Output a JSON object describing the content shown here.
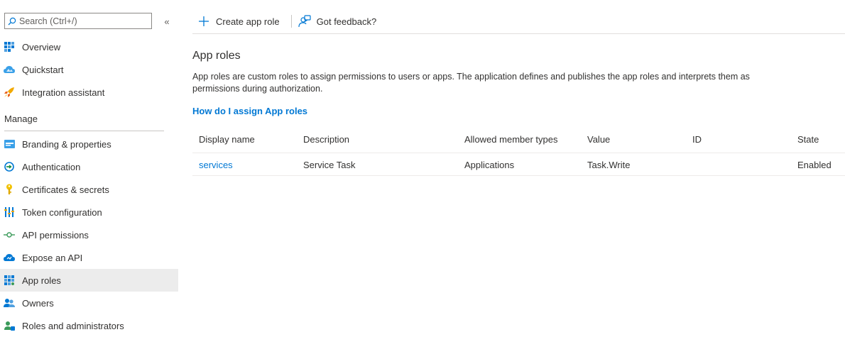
{
  "search": {
    "placeholder": "Search (Ctrl+/)"
  },
  "sidebar": {
    "collapse_glyph": "«",
    "top_items": [
      {
        "label": "Overview",
        "icon": "overview-icon"
      },
      {
        "label": "Quickstart",
        "icon": "quickstart-icon"
      },
      {
        "label": "Integration assistant",
        "icon": "rocket-icon"
      }
    ],
    "section_title": "Manage",
    "manage_items": [
      {
        "label": "Branding & properties",
        "icon": "branding-icon"
      },
      {
        "label": "Authentication",
        "icon": "authentication-icon"
      },
      {
        "label": "Certificates & secrets",
        "icon": "key-icon"
      },
      {
        "label": "Token configuration",
        "icon": "token-icon"
      },
      {
        "label": "API permissions",
        "icon": "api-permissions-icon"
      },
      {
        "label": "Expose an API",
        "icon": "cloud-icon"
      },
      {
        "label": "App roles",
        "icon": "app-roles-icon",
        "active": true
      },
      {
        "label": "Owners",
        "icon": "owners-icon"
      },
      {
        "label": "Roles and administrators",
        "icon": "roles-admin-icon"
      }
    ]
  },
  "toolbar": {
    "create_label": "Create app role",
    "feedback_label": "Got feedback?"
  },
  "main": {
    "title": "App roles",
    "description": "App roles are custom roles to assign permissions to users or apps. The application defines and publishes the app roles and interprets them as permissions during authorization.",
    "help_link": "How do I assign App roles"
  },
  "table": {
    "columns": [
      "Display name",
      "Description",
      "Allowed member types",
      "Value",
      "ID",
      "State"
    ],
    "rows": [
      {
        "display_name": "services",
        "description": "Service Task",
        "allowed_member_types": "Applications",
        "value": "Task.Write",
        "id": "",
        "state": "Enabled"
      }
    ]
  },
  "colors": {
    "accent": "#0078d4",
    "active_bg": "#ececec",
    "text": "#323130"
  }
}
